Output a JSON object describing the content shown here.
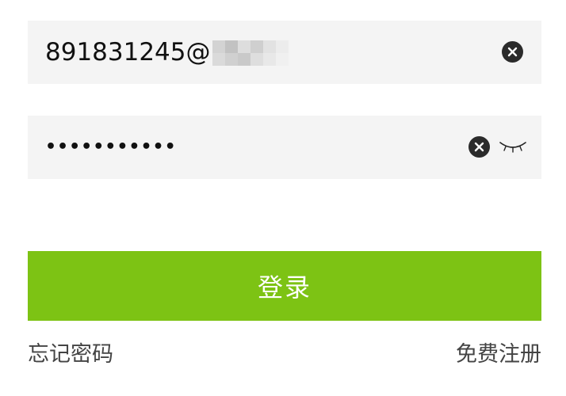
{
  "account_field": {
    "value_prefix": "891831245@",
    "redacted_part": "[blurred]"
  },
  "password_field": {
    "masked_value": "•••••••••••"
  },
  "icons": {
    "clear": "close-circle-icon",
    "visibility": "eye-closed-icon"
  },
  "login_button": {
    "label": "登录"
  },
  "links": {
    "forgot_password": "忘记密码",
    "register": "免费注册"
  },
  "colors": {
    "accent": "#7dc314",
    "field_bg": "#f4f4f4",
    "text": "#111111",
    "link_text": "#444444",
    "clear_icon_bg": "#2b2b2b"
  }
}
